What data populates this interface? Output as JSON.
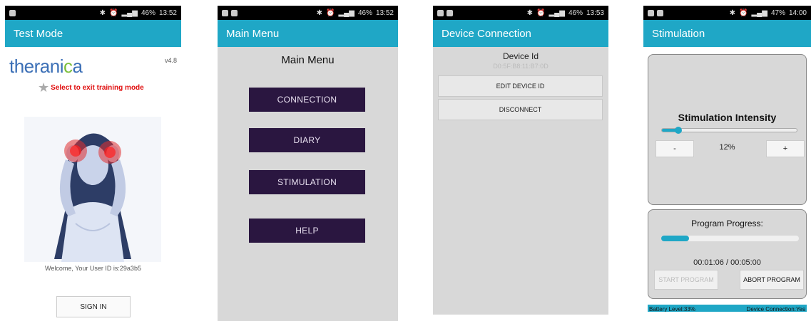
{
  "phones": {
    "p1": {
      "status_time": "13:52",
      "status_battery": "46%",
      "appbar_title": "Test Mode",
      "logo_text": "therani",
      "logo_text_i": "c",
      "logo_text_end": "a",
      "version": "v4.8",
      "exit_link": "Select to exit training mode",
      "welcome": "Welcome, Your User ID is:29a3b5",
      "sign_in": "SIGN IN"
    },
    "p2": {
      "status_time": "13:52",
      "status_battery": "46%",
      "appbar_title": "Main Menu",
      "title": "Main Menu",
      "buttons": [
        "CONNECTION",
        "DIARY",
        "STIMULATION",
        "HELP"
      ]
    },
    "p3": {
      "status_time": "13:53",
      "status_battery": "46%",
      "appbar_title": "Device Connection",
      "device_label": "Device Id",
      "device_id": "D0:5F:B8:11:B7:0D",
      "edit_button": "EDIT DEVICE ID",
      "disconnect_button": "DISCONNECT"
    },
    "p4": {
      "status_time": "14:00",
      "status_battery": "47%",
      "appbar_title": "Stimulation",
      "intensity_title": "Stimulation Intensity",
      "intensity_value": 0.12,
      "intensity_text": "12%",
      "minus_label": "-",
      "plus_label": "+",
      "progress_title": "Program Progress:",
      "progress_value": 0.2,
      "progress_time": "00:01:06 / 00:05:00",
      "start_button": "START PROGRAM",
      "abort_button": "ABORT PROGRAM",
      "battery_level": "Battery Level:33%",
      "device_connection": "Device Connection:Yes"
    }
  },
  "colors": {
    "accent": "#1fa7c6",
    "menu_button": "#2a1640",
    "exit_red": "#e01010"
  }
}
